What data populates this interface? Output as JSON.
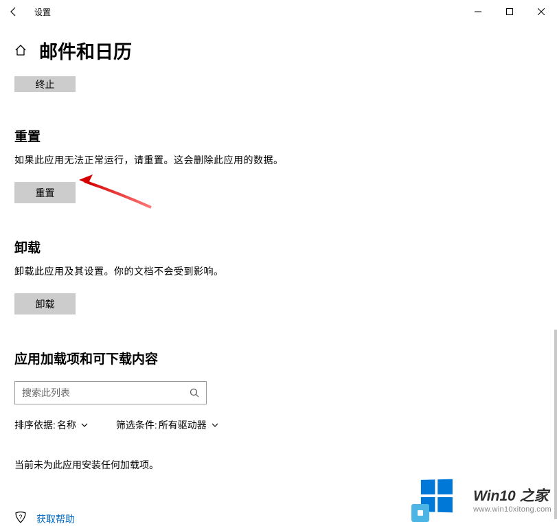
{
  "titlebar": {
    "title": "设置"
  },
  "header": {
    "page_title": "邮件和日历"
  },
  "terminate": {
    "button_label": "终止"
  },
  "reset": {
    "heading": "重置",
    "description": "如果此应用无法正常运行，请重置。这会删除此应用的数据。",
    "button_label": "重置"
  },
  "uninstall": {
    "heading": "卸载",
    "description": "卸载此应用及其设置。你的文档不会受到影响。",
    "button_label": "卸载"
  },
  "addons": {
    "heading": "应用加载项和可下载内容",
    "search_placeholder": "搜索此列表",
    "sort_label": "排序依据:",
    "sort_value": "名称",
    "filter_label": "筛选条件:",
    "filter_value": "所有驱动器",
    "empty_message": "当前未为此应用安装任何加载项。"
  },
  "help": {
    "link_text": "获取帮助"
  },
  "watermark": {
    "main": "Win10 之家",
    "sub": "www.win10xitong.com"
  }
}
